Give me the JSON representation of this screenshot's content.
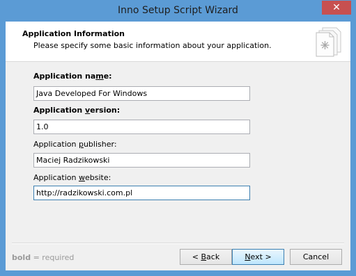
{
  "window": {
    "title": "Inno Setup Script Wizard",
    "close_glyph": "✕"
  },
  "header": {
    "title": "Application Information",
    "subtitle": "Please specify some basic information about your application.",
    "icon": "wizard-page-icon"
  },
  "fields": [
    {
      "pre": "Application na",
      "key": "m",
      "post": "e:",
      "required": true,
      "value": "Java Developed For Windows"
    },
    {
      "pre": "Application ",
      "key": "v",
      "post": "ersion:",
      "required": true,
      "value": "1.0"
    },
    {
      "pre": "Application ",
      "key": "p",
      "post": "ublisher:",
      "required": false,
      "value": "Maciej Radzikowski"
    },
    {
      "pre": "Application ",
      "key": "w",
      "post": "ebsite:",
      "required": false,
      "value": "http://radzikowski.com.pl"
    }
  ],
  "footer": {
    "legend_bold": "bold",
    "legend_rest": " = required",
    "back_pre": "< ",
    "back_key": "B",
    "back_post": "ack",
    "next_key": "N",
    "next_post": "ext >",
    "cancel_label": "Cancel"
  },
  "colors": {
    "titlebar": "#5b9bd5",
    "close_button": "#c75050",
    "focus_border": "#3c7fb1"
  }
}
